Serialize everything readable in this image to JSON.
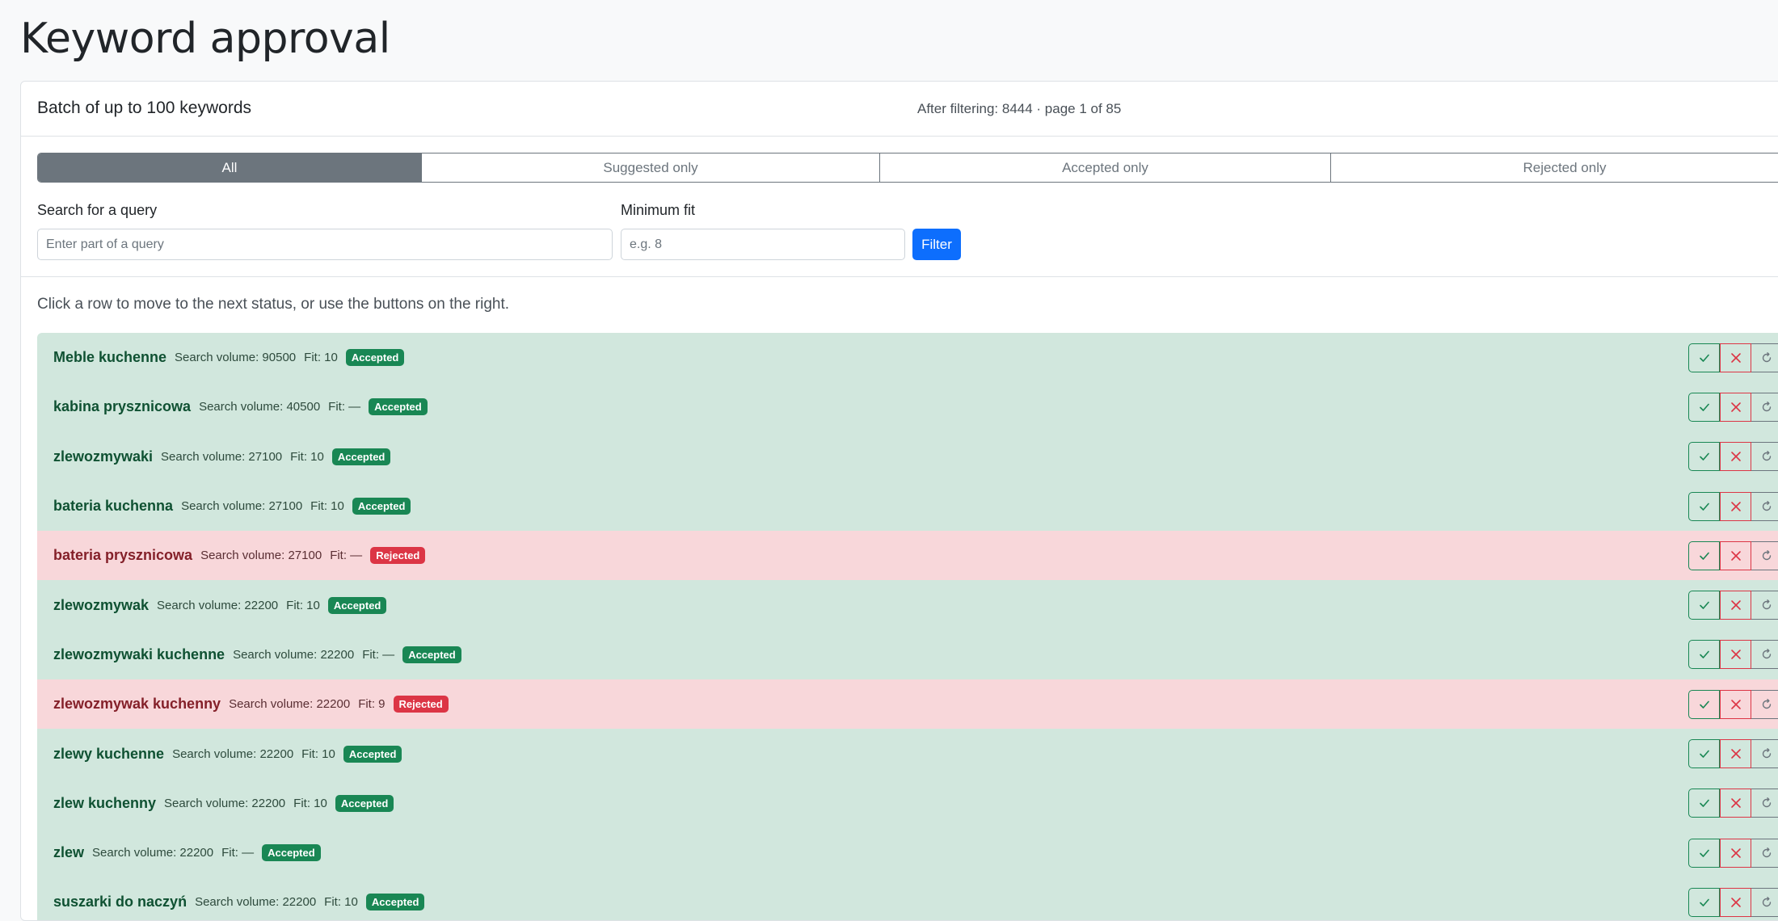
{
  "page": {
    "title": "Keyword approval"
  },
  "card": {
    "title": "Batch of up to 100 keywords",
    "meta": "After filtering: 8444 · page 1 of 85"
  },
  "tabs": [
    {
      "label": "All",
      "active": true
    },
    {
      "label": "Suggested only",
      "active": false
    },
    {
      "label": "Accepted only",
      "active": false
    },
    {
      "label": "Rejected only",
      "active": false
    }
  ],
  "filters": {
    "search_label": "Search for a query",
    "search_placeholder": "Enter part of a query",
    "fit_label": "Minimum fit",
    "fit_placeholder": "e.g. 8",
    "filter_button": "Filter"
  },
  "hint": "Click a row to move to the next status, or use the buttons on the right.",
  "rows": [
    {
      "keyword": "Meble kuchenne",
      "volume": "Search volume: 90500",
      "fit": "Fit: 10",
      "status": "accepted",
      "badge": "Accepted"
    },
    {
      "keyword": "kabina prysznicowa",
      "volume": "Search volume: 40500",
      "fit": "Fit: —",
      "status": "accepted",
      "badge": "Accepted"
    },
    {
      "keyword": "zlewozmywaki",
      "volume": "Search volume: 27100",
      "fit": "Fit: 10",
      "status": "accepted",
      "badge": "Accepted"
    },
    {
      "keyword": "bateria kuchenna",
      "volume": "Search volume: 27100",
      "fit": "Fit: 10",
      "status": "accepted",
      "badge": "Accepted"
    },
    {
      "keyword": "bateria prysznicowa",
      "volume": "Search volume: 27100",
      "fit": "Fit: —",
      "status": "rejected",
      "badge": "Rejected"
    },
    {
      "keyword": "zlewozmywak",
      "volume": "Search volume: 22200",
      "fit": "Fit: 10",
      "status": "accepted",
      "badge": "Accepted"
    },
    {
      "keyword": "zlewozmywaki kuchenne",
      "volume": "Search volume: 22200",
      "fit": "Fit: —",
      "status": "accepted",
      "badge": "Accepted"
    },
    {
      "keyword": "zlewozmywak kuchenny",
      "volume": "Search volume: 22200",
      "fit": "Fit: 9",
      "status": "rejected",
      "badge": "Rejected"
    },
    {
      "keyword": "zlewy kuchenne",
      "volume": "Search volume: 22200",
      "fit": "Fit: 10",
      "status": "accepted",
      "badge": "Accepted"
    },
    {
      "keyword": "zlew kuchenny",
      "volume": "Search volume: 22200",
      "fit": "Fit: 10",
      "status": "accepted",
      "badge": "Accepted"
    },
    {
      "keyword": "zlew",
      "volume": "Search volume: 22200",
      "fit": "Fit: —",
      "status": "accepted",
      "badge": "Accepted"
    },
    {
      "keyword": "suszarki do naczyń",
      "volume": "Search volume: 22200",
      "fit": "Fit: 10",
      "status": "accepted",
      "badge": "Accepted"
    }
  ],
  "colors": {
    "accepted_bg": "#d1e7dd",
    "rejected_bg": "#f8d7da",
    "accepted_badge": "#198754",
    "rejected_badge": "#dc3545",
    "primary": "#0d6efd",
    "secondary": "#6c757d"
  },
  "icons": {
    "accept": "check-icon",
    "reject": "x-icon",
    "reset": "reset-icon"
  }
}
